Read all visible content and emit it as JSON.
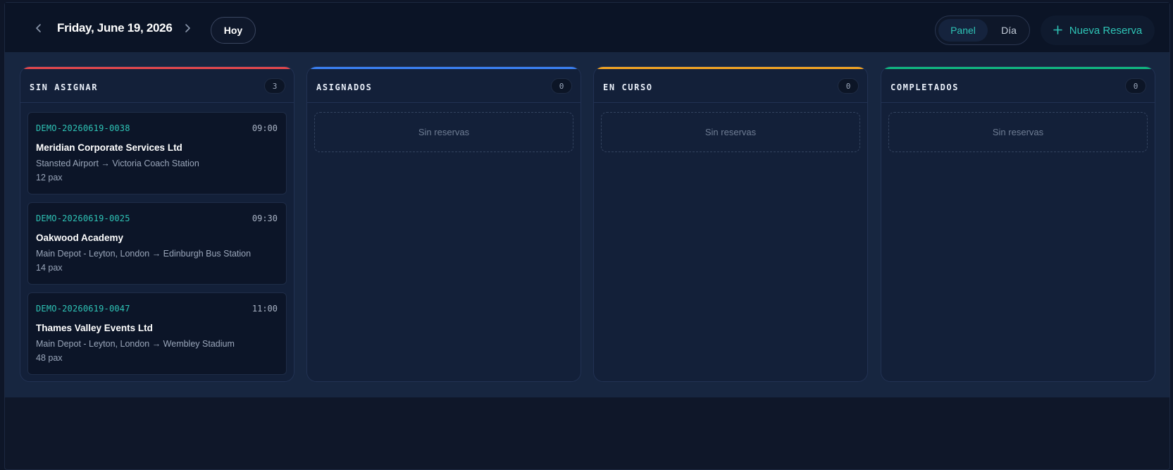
{
  "header": {
    "date_title": "Friday, June 19, 2026",
    "today_label": "Hoy",
    "prev_icon": "chevron-left-icon",
    "next_icon": "chevron-right-icon",
    "views": {
      "panel": "Panel",
      "dia": "Día",
      "active": "Panel"
    },
    "new_booking_label": "Nueva Reserva",
    "new_booking_icon": "plus-icon"
  },
  "colors": {
    "accent_teal": "#2ec4b6",
    "unassigned": "#e5484d",
    "assigned": "#3b82f6",
    "in_progress": "#f5a623",
    "completed": "#10b981"
  },
  "columns": [
    {
      "title": "SIN ASIGNAR",
      "count": "3",
      "cards": [
        {
          "code": "DEMO-20260619-0038",
          "time": "09:00",
          "client": "Meridian Corporate Services Ltd",
          "route": "Stansted Airport → Victoria Coach Station",
          "pax": "12 pax"
        },
        {
          "code": "DEMO-20260619-0025",
          "time": "09:30",
          "client": "Oakwood Academy",
          "route": "Main Depot - Leyton, London → Edinburgh Bus Station",
          "pax": "14 pax"
        },
        {
          "code": "DEMO-20260619-0047",
          "time": "11:00",
          "client": "Thames Valley Events Ltd",
          "route": "Main Depot - Leyton, London → Wembley Stadium",
          "pax": "48 pax"
        }
      ]
    },
    {
      "title": "ASIGNADOS",
      "count": "0",
      "empty_label": "Sin reservas"
    },
    {
      "title": "EN CURSO",
      "count": "0",
      "empty_label": "Sin reservas"
    },
    {
      "title": "COMPLETADOS",
      "count": "0",
      "empty_label": "Sin reservas"
    }
  ]
}
